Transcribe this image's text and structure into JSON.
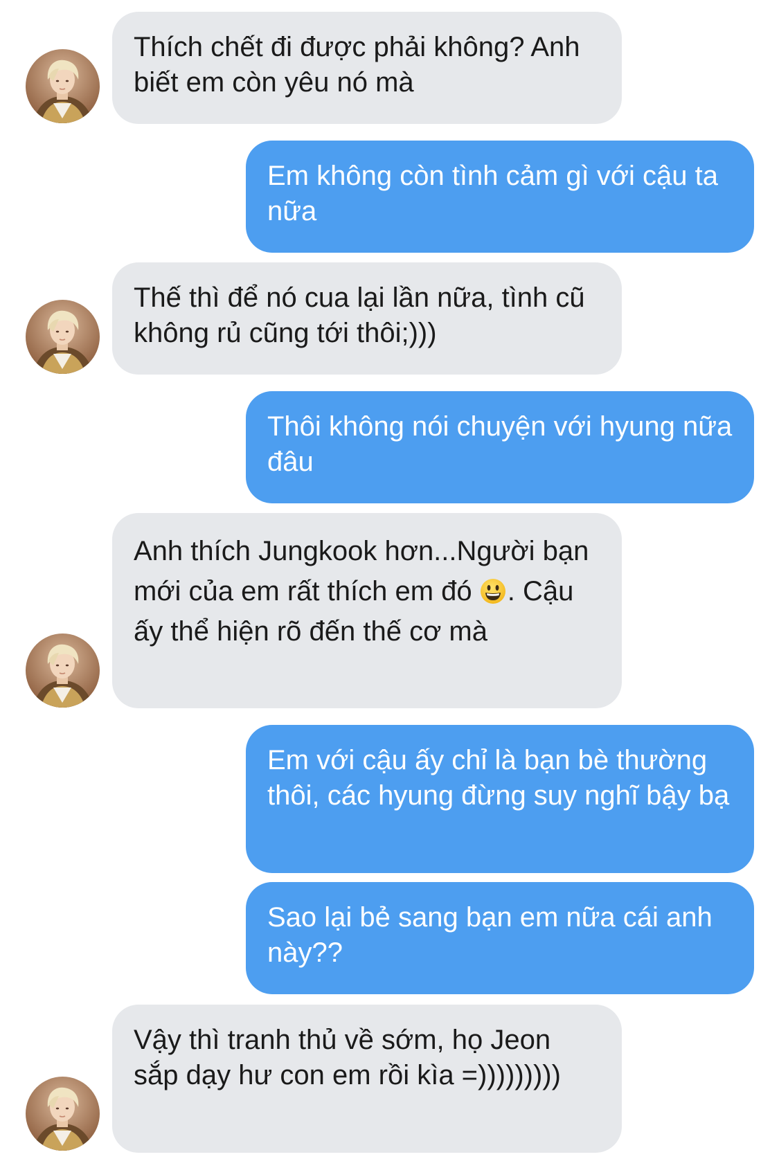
{
  "conversation": {
    "messages": [
      {
        "from": "incoming",
        "text": "Thích chết đi được phải không? Anh biết em còn yêu nó mà"
      },
      {
        "from": "outgoing",
        "text": "Em không còn tình cảm gì với cậu ta nữa"
      },
      {
        "from": "incoming",
        "text": "Thế thì để nó cua lại lần nữa, tình cũ không rủ cũng tới thôi;)))"
      },
      {
        "from": "outgoing",
        "text": "Thôi không nói chuyện với hyung nữa đâu"
      },
      {
        "from": "incoming",
        "text_before_emoji": "Anh thích Jungkook hơn...Người bạn mới của em rất thích em đó ",
        "emoji": "grinning-face",
        "text_after_emoji": ". Cậu ấy thể hiện rõ đến thế cơ mà"
      },
      {
        "from": "outgoing",
        "text": "Em với cậu ấy chỉ là bạn bè thường thôi, các hyung đừng suy nghĩ bậy bạ"
      },
      {
        "from": "outgoing",
        "text": "Sao lại bẻ sang bạn em nữa cái anh này??"
      },
      {
        "from": "incoming",
        "text": "Vậy thì tranh thủ về sớm, họ Jeon sắp dạy hư con em rồi kìa =)))))))))"
      }
    ]
  },
  "colors": {
    "incoming_bubble": "#e6e8eb",
    "outgoing_bubble": "#4d9ef0",
    "incoming_text": "#1a1a1a",
    "outgoing_text": "#ffffff"
  },
  "icons": {
    "avatar": "contact-avatar-photo",
    "emoji": "grinning-face-emoji"
  }
}
